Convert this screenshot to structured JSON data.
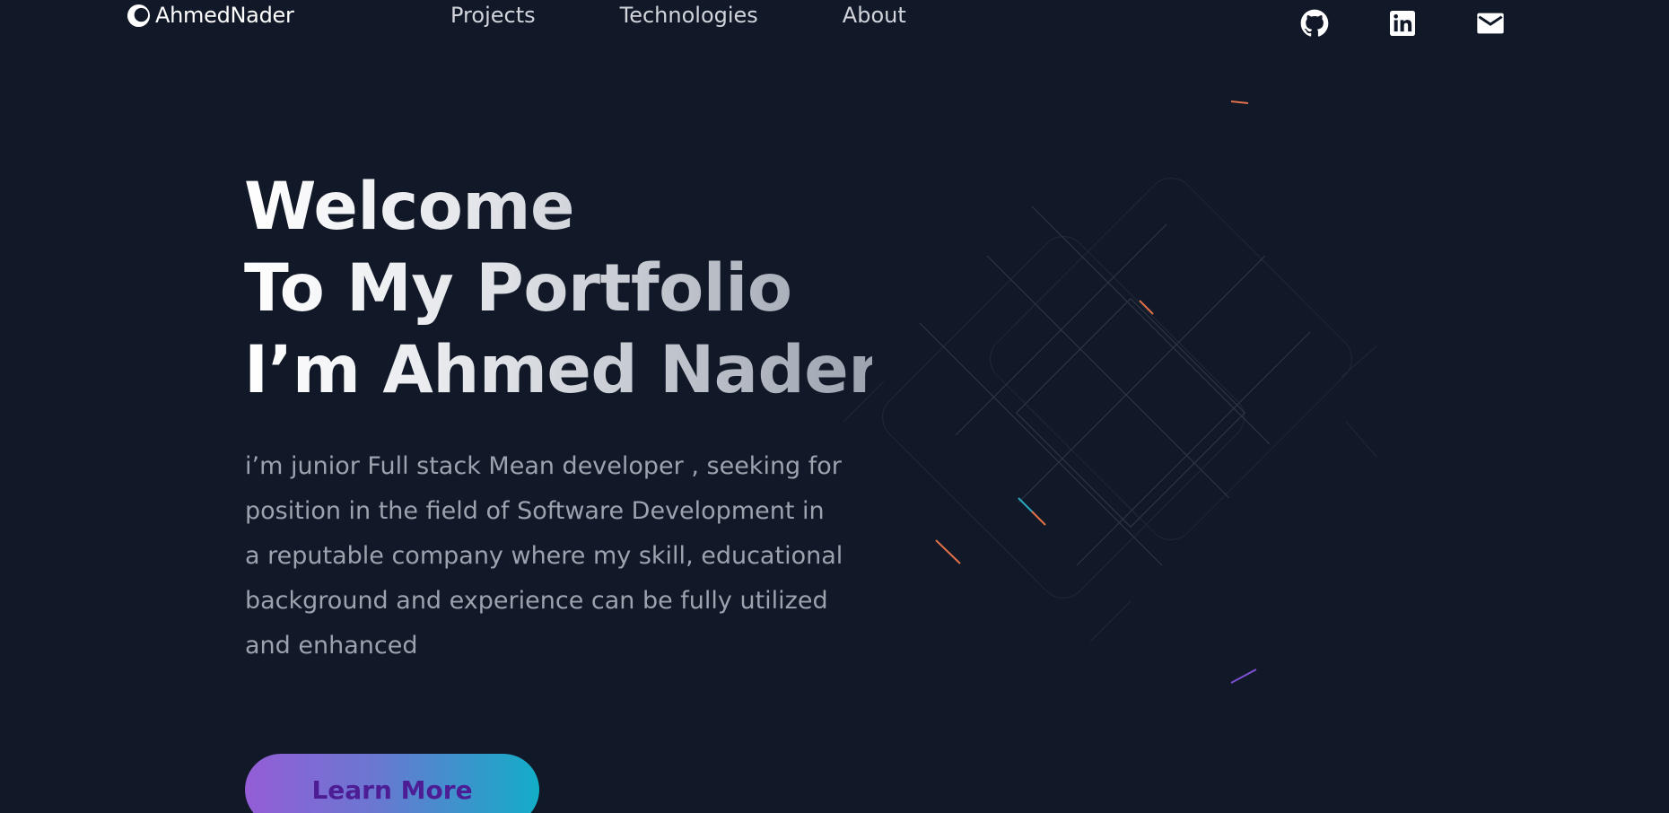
{
  "brand": {
    "name": "AhmedNader"
  },
  "nav": {
    "links": [
      {
        "label": "Projects"
      },
      {
        "label": "Technologies"
      },
      {
        "label": "About"
      }
    ]
  },
  "social": [
    {
      "icon": "github-icon"
    },
    {
      "icon": "linkedin-icon"
    },
    {
      "icon": "mail-icon"
    }
  ],
  "hero": {
    "title_lines": [
      "Welcome",
      "To My Portfolio",
      "I’m Ahmed Nader"
    ],
    "description": "i’m junior Full stack Mean developer , seeking for position in the field of Software Development in a reputable company where my skill, educational background and experience can be fully utilized and enhanced",
    "cta_label": "Learn More"
  },
  "colors": {
    "background": "#111827",
    "nav_text": "#d1d5db",
    "description_text": "#9ca3af",
    "cta_gradient_start": "#945dd6",
    "cta_gradient_end": "#13adc7",
    "cta_text": "#4c1d95"
  }
}
